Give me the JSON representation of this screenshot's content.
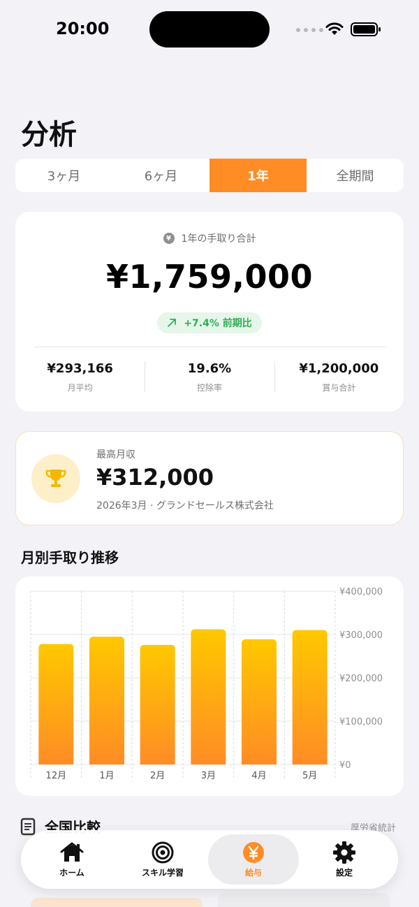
{
  "status_bar": {
    "time": "20:00"
  },
  "title": "分析",
  "periods": [
    {
      "label": "3ヶ月",
      "active": false
    },
    {
      "label": "6ヶ月",
      "active": false
    },
    {
      "label": "1年",
      "active": true
    },
    {
      "label": "全期間",
      "active": false
    }
  ],
  "summary": {
    "label": "1年の手取り合計",
    "amount": "¥1,759,000",
    "change": "+7.4% 前期比",
    "stats": [
      {
        "value": "¥293,166",
        "label": "月平均"
      },
      {
        "value": "19.6%",
        "label": "控除率"
      },
      {
        "value": "¥1,200,000",
        "label": "賞与合計"
      }
    ]
  },
  "best_month": {
    "label": "最高月収",
    "amount": "¥312,000",
    "detail": "2026年3月 · グランドセールス株式会社"
  },
  "trend_title": "月別手取り推移",
  "chart_data": {
    "type": "bar",
    "categories": [
      "12月",
      "1月",
      "2月",
      "3月",
      "4月",
      "5月"
    ],
    "values": [
      278000,
      295000,
      276000,
      312000,
      289000,
      310000
    ],
    "ylim": [
      0,
      400000
    ],
    "yticks": [
      0,
      100000,
      200000,
      300000,
      400000
    ],
    "ytick_labels": [
      "¥0",
      "¥100,000",
      "¥200,000",
      "¥300,000",
      "¥400,000"
    ],
    "colors": {
      "top": "#ffc800",
      "bottom": "#ff8c25"
    },
    "grid": true
  },
  "compare": {
    "title": "全国比較",
    "source": "厚労省統計"
  },
  "tabs": [
    {
      "label": "ホーム",
      "icon": "home-icon",
      "active": false
    },
    {
      "label": "スキル学習",
      "icon": "target-icon",
      "active": false
    },
    {
      "label": "給与",
      "icon": "yen-icon",
      "active": true
    },
    {
      "label": "設定",
      "icon": "gear-icon",
      "active": false
    }
  ],
  "colors": {
    "accent": "#ff8c25",
    "positive": "#2fae55",
    "background": "#f2f2f7"
  }
}
